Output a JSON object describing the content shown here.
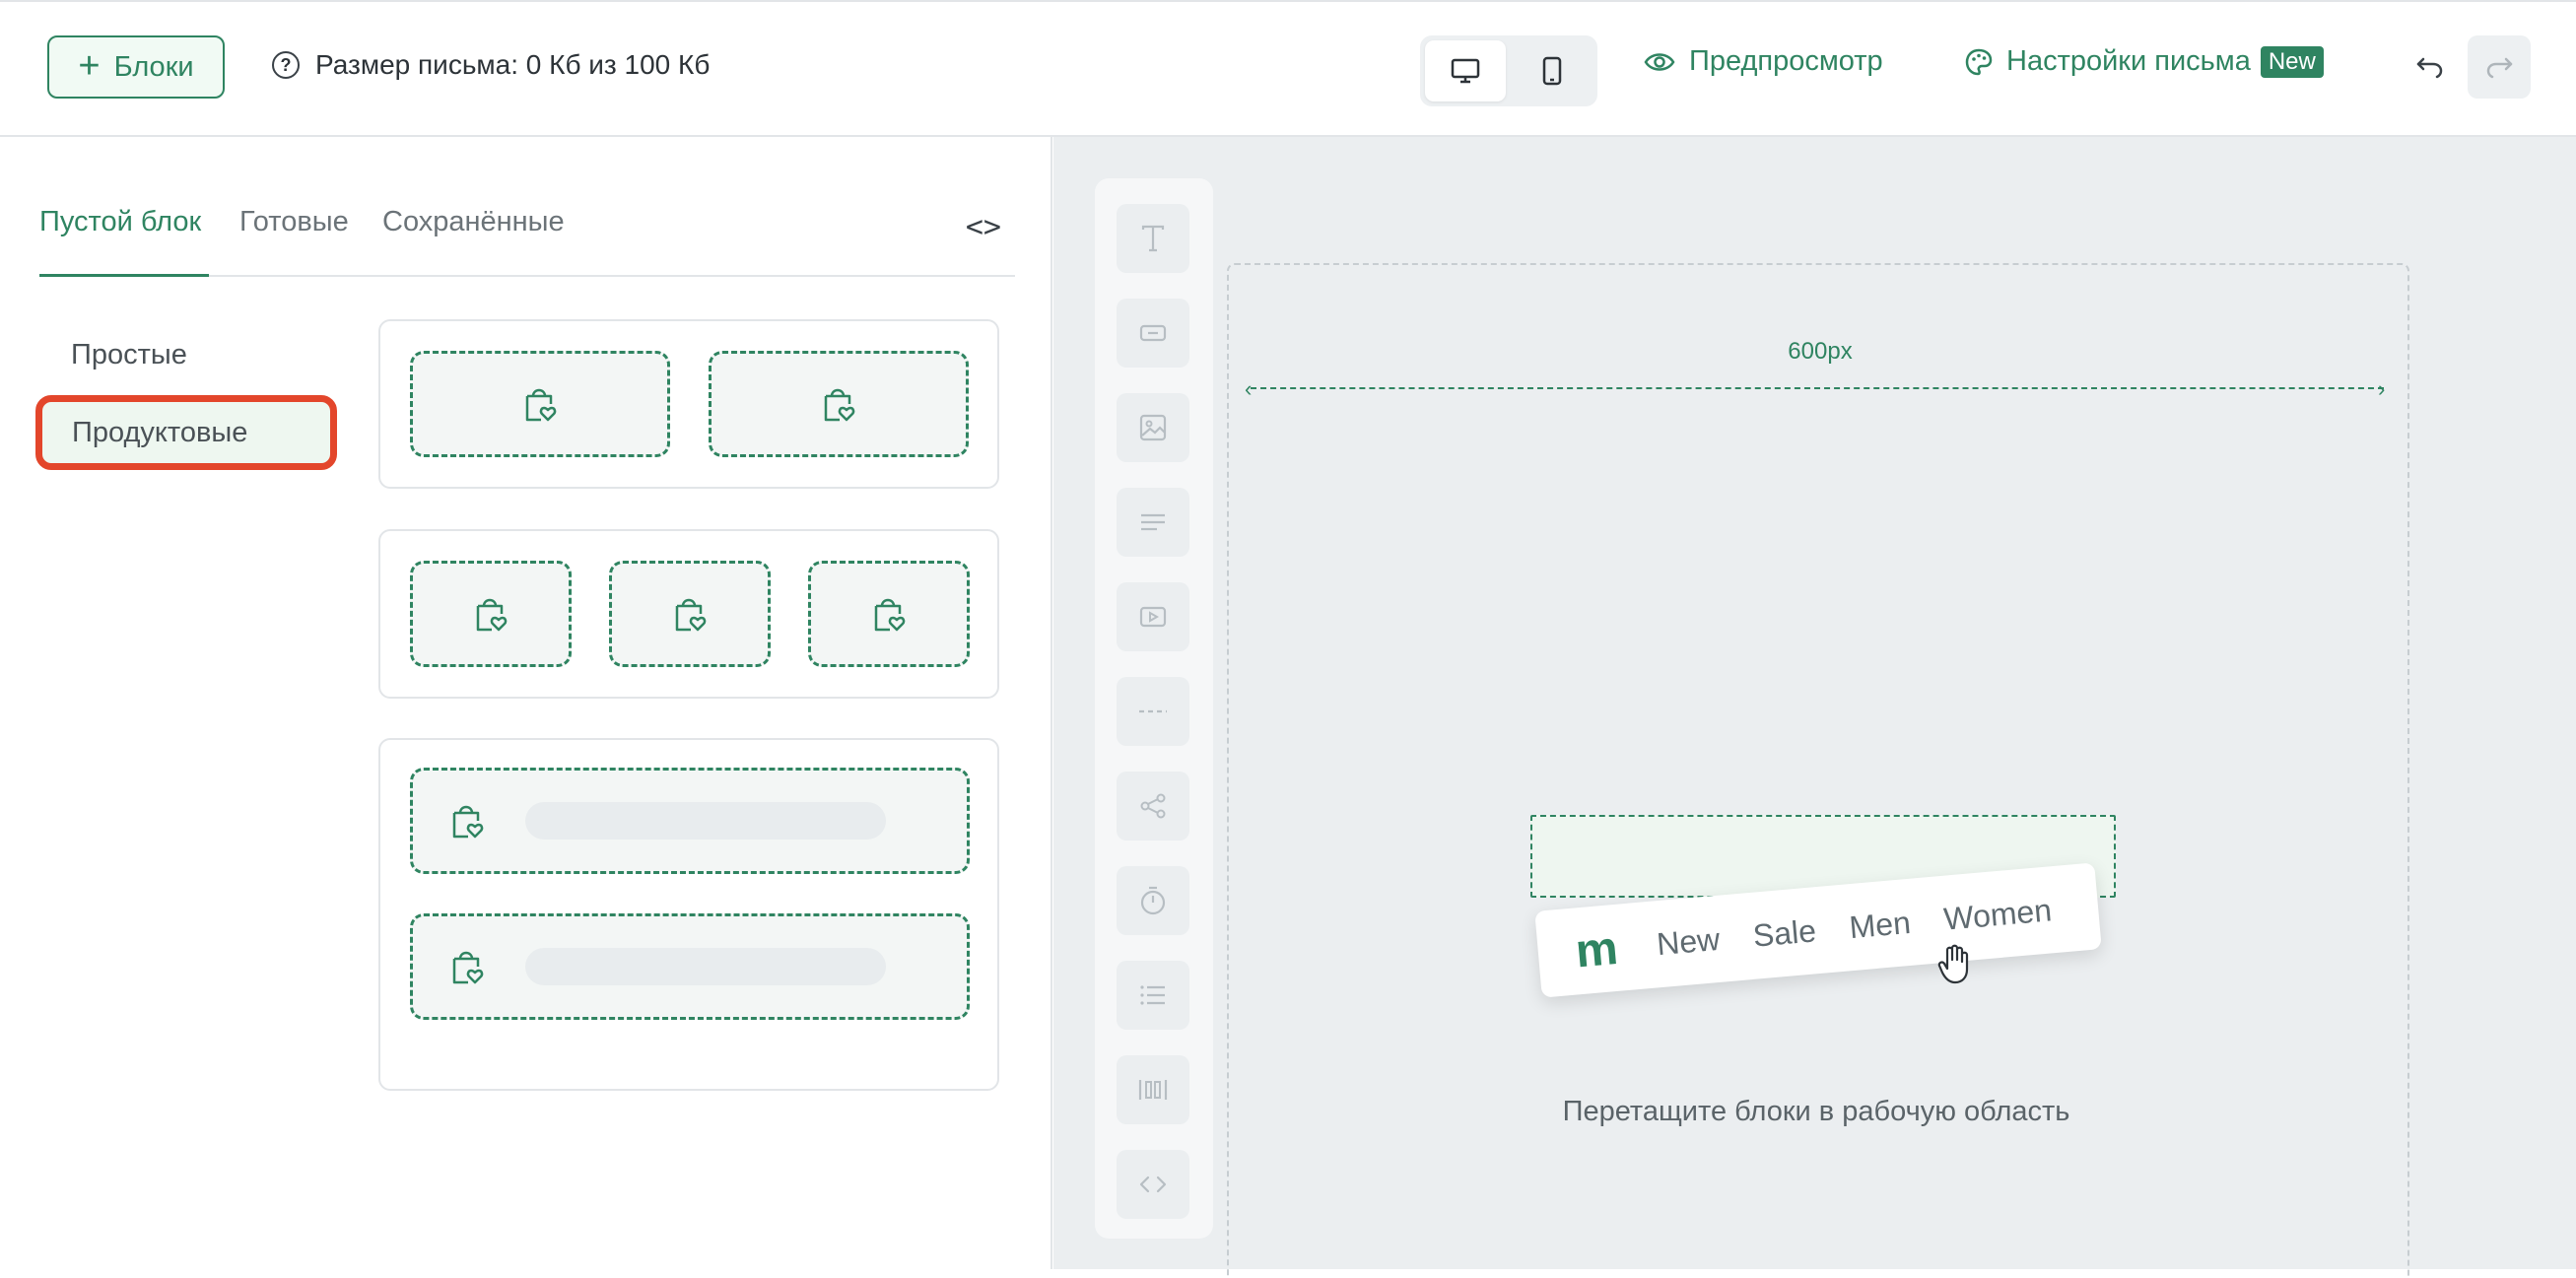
{
  "header": {
    "blocks_button": "Блоки",
    "size_info": "Размер письма: 0 Кб из 100 Кб",
    "preview_label": "Предпросмотр",
    "settings_label": "Настройки письма",
    "new_badge": "New"
  },
  "tabs": {
    "empty": "Пустой блок",
    "ready": "Готовые",
    "saved": "Сохранённые",
    "code": "<>"
  },
  "categories": {
    "simple": "Простые",
    "product": "Продуктовые"
  },
  "canvas": {
    "width_label": "600px",
    "drop_hint": "Перетащите блоки в рабочую область",
    "drag_card": {
      "logo": "m",
      "items": [
        "New",
        "Sale",
        "Men",
        "Women"
      ]
    }
  },
  "colors": {
    "accent": "#2f8461",
    "highlight": "#e3462b",
    "canvas_bg": "#ebeef0"
  },
  "icons": {
    "blocks_button": "plus-icon",
    "size_info": "help-circle-icon",
    "desktop": "monitor-icon",
    "mobile": "smartphone-icon",
    "preview": "eye-icon",
    "settings": "palette-icon",
    "undo": "undo-icon",
    "redo": "redo-icon",
    "product_slot": "shopping-bag-heart-icon",
    "toolbar": [
      "text-icon",
      "button-icon",
      "image-icon",
      "paragraph-icon",
      "video-icon",
      "divider-icon",
      "share-icon",
      "timer-icon",
      "list-icon",
      "columns-icon",
      "code-icon"
    ]
  }
}
